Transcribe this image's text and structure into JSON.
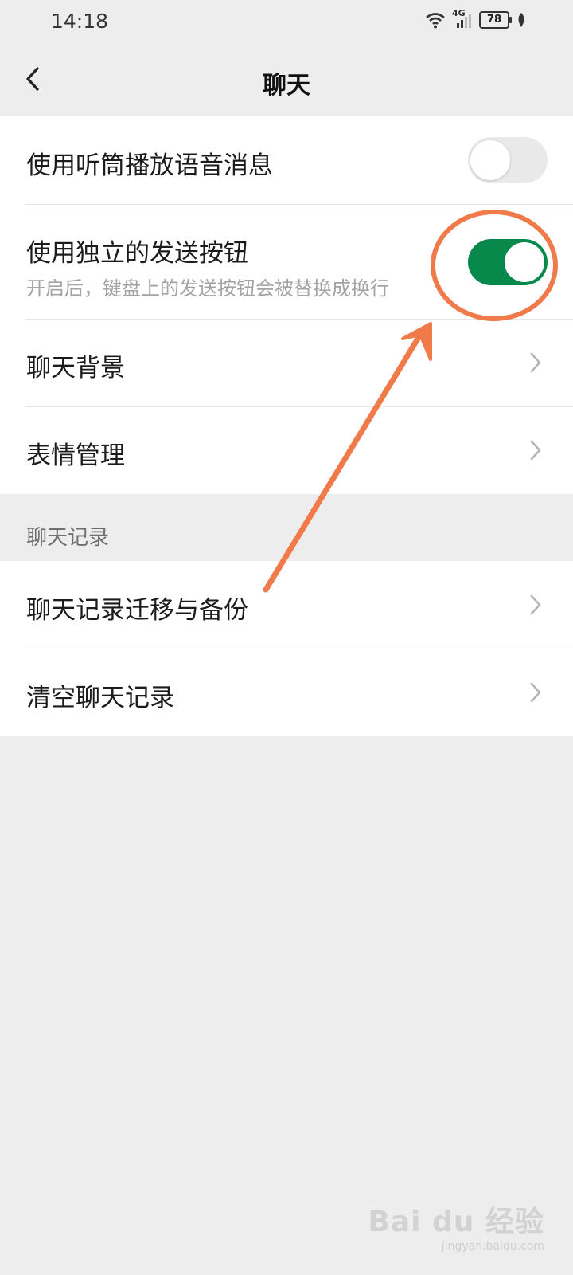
{
  "status_bar": {
    "time": "14:18",
    "network": "4G",
    "battery": "78",
    "icons": [
      "wifi-icon",
      "signal-icon",
      "battery-icon",
      "leaf-icon"
    ]
  },
  "header": {
    "title": "聊天",
    "back_icon": "chevron-left-icon"
  },
  "settings": {
    "earpiece": {
      "label": "使用听筒播放语音消息",
      "enabled": false
    },
    "send_button": {
      "label": "使用独立的发送按钮",
      "description": "开启后，键盘上的发送按钮会被替换成换行",
      "enabled": true
    },
    "background": {
      "label": "聊天背景"
    },
    "stickers": {
      "label": "表情管理"
    }
  },
  "history": {
    "header": "聊天记录",
    "items": [
      {
        "label": "聊天记录迁移与备份"
      },
      {
        "label": "清空聊天记录"
      }
    ]
  },
  "annotation": {
    "color": "#f07a4a",
    "shape": "circle-and-arrow",
    "target": "send_button toggle"
  },
  "watermark": {
    "logo": "Bai du 经验",
    "url": "jingyan.baidu.com"
  },
  "colors": {
    "accent_green": "#07894c",
    "background": "#ededed",
    "annotation": "#f07a4a"
  }
}
